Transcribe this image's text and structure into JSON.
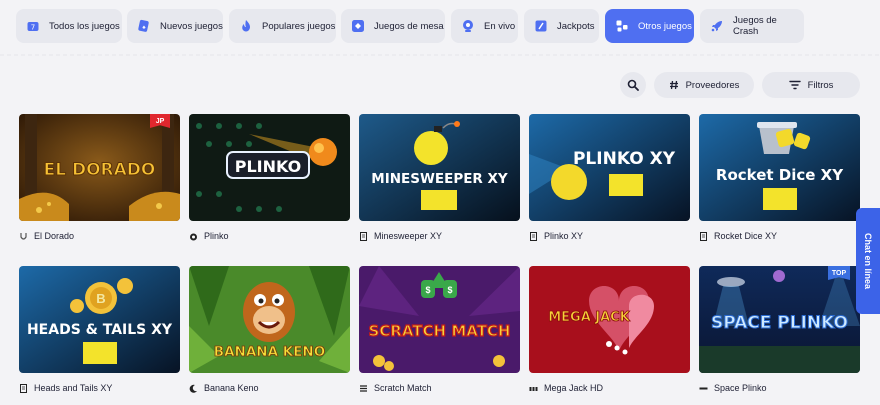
{
  "categories": [
    {
      "label": "Todos los juegos",
      "icon": "all-games-icon"
    },
    {
      "label": "Nuevos juegos",
      "icon": "new-games-icon"
    },
    {
      "label": "Populares juegos",
      "icon": "popular-icon"
    },
    {
      "label": "Juegos de mesa",
      "icon": "table-games-icon"
    },
    {
      "label": "En vivo",
      "icon": "live-icon"
    },
    {
      "label": "Jackpots",
      "icon": "jackpot-icon"
    },
    {
      "label": "Otros juegos",
      "icon": "other-games-icon"
    },
    {
      "label": "Juegos de Crash",
      "icon": "rocket-icon"
    }
  ],
  "active_category": "Otros juegos",
  "toolbar": {
    "providers": "Proveedores",
    "filters": "Filtros"
  },
  "games": [
    {
      "name": "El Dorado",
      "art": "EL DORADO",
      "badge": "JP",
      "provider_icon": "horseshoe-icon"
    },
    {
      "name": "Plinko",
      "art": "PLINKO",
      "provider_icon": "flame-icon"
    },
    {
      "name": "Minesweeper XY",
      "art": "MINESWEEPER XY",
      "provider_icon": "document-icon"
    },
    {
      "name": "Plinko XY",
      "art": "PLINKO XY",
      "provider_icon": "document-icon"
    },
    {
      "name": "Rocket Dice XY",
      "art": "Rocket Dice XY",
      "provider_icon": "document-icon"
    },
    {
      "name": "Heads and Tails XY",
      "art": "HEADS & TAILS XY",
      "provider_icon": "document-icon"
    },
    {
      "name": "Banana Keno",
      "art": "BANANA KENO",
      "provider_icon": "moon-icon"
    },
    {
      "name": "Scratch Match",
      "art": "SCRATCH MATCH",
      "provider_icon": "stack-icon"
    },
    {
      "name": "Mega Jack HD",
      "art": "MEGA JACK",
      "provider_icon": "bars-icon"
    },
    {
      "name": "Space Plinko",
      "art": "SPACE PLINKO",
      "badge": "TOP",
      "provider_icon": "dash-icon"
    }
  ],
  "chat": "Chat en línea",
  "colors": {
    "accent": "#4f6ff1",
    "chat": "#3c63e8",
    "jp_badge": "#e0272e",
    "top_badge": "#3a6fe0"
  }
}
